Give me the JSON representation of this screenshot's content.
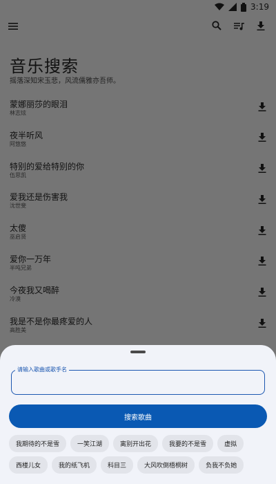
{
  "status_bar": {
    "time": "3:19",
    "icons": [
      "wifi-icon",
      "signal-icon",
      "battery-icon"
    ]
  },
  "app_bar": {
    "icons": [
      "menu-icon",
      "search-icon",
      "playlist-icon",
      "download-icon"
    ]
  },
  "header": {
    "title": "音乐搜索",
    "subtitle": "摇落深知宋玉悲，风流儒雅亦吾师。"
  },
  "songs": [
    {
      "title": "蒙娜丽莎的眼泪",
      "artist": "林志炫"
    },
    {
      "title": "夜半听风",
      "artist": "阿悠悠"
    },
    {
      "title": "特别的爱给特别的你",
      "artist": "伍思凯"
    },
    {
      "title": "爱我还是伤害我",
      "artist": "沈世斐"
    },
    {
      "title": "太傻",
      "artist": "巫启贤"
    },
    {
      "title": "爱你一万年",
      "artist": "半吨兄弟"
    },
    {
      "title": "今夜我又喝醉",
      "artist": "冷漠"
    },
    {
      "title": "我是不是你最疼爱的人",
      "artist": "高胜美"
    }
  ],
  "search": {
    "label": "请输入歌曲或歌手名",
    "value": "",
    "button_label": "搜索歌曲"
  },
  "suggestions": {
    "row1": [
      "我期待的不是雪",
      "一笑江湖",
      "离别开出花",
      "我要的不是雪",
      "虚拟"
    ],
    "row2": [
      "西楼儿女",
      "我的纸飞机",
      "科目三",
      "大风吹倒梧桐树",
      "负我不负她"
    ]
  },
  "colors": {
    "accent": "#0a59b3",
    "sheet_bg": "#f1f3f9",
    "overlay_bg": "#757575"
  }
}
